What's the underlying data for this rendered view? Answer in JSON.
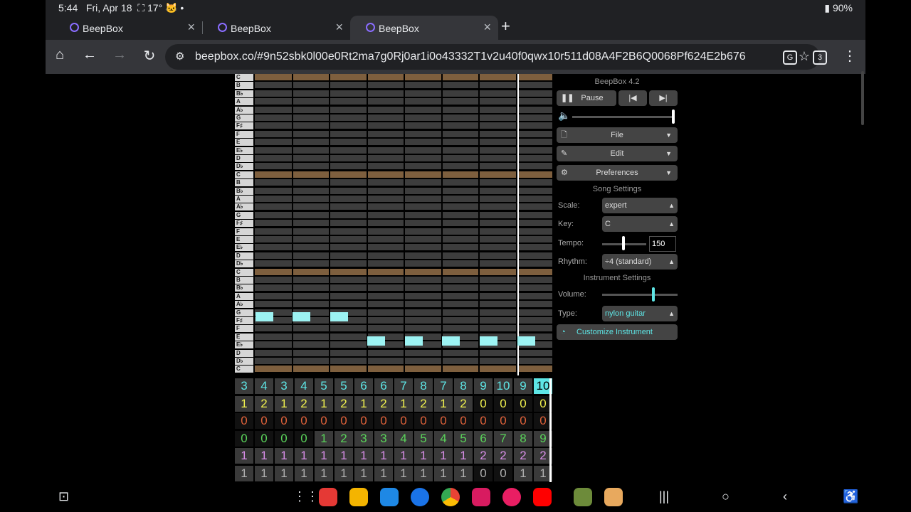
{
  "status_bar": {
    "time": "5:44",
    "date": "Fri, Apr 18",
    "temp": "17°",
    "battery": "90%"
  },
  "tabs": [
    {
      "title": "BeepBox",
      "active": false
    },
    {
      "title": "BeepBox",
      "active": false
    },
    {
      "title": "BeepBox",
      "active": true
    }
  ],
  "toolbar": {
    "url": "beepbox.co/#9n52sbk0l00e0Rt2ma7g0Rj0ar1i0o43332T1v2u40f0qwx10r511d08A4F2B6Q0068Pf624E2b676",
    "tab_count": "3"
  },
  "piano_keys": [
    "C",
    "B",
    "B♭",
    "A",
    "A♭",
    "G",
    "F♯",
    "F",
    "E",
    "E♭",
    "D",
    "D♭",
    "C",
    "B",
    "B♭",
    "A",
    "A♭",
    "G",
    "F♯",
    "F",
    "E",
    "E♭",
    "D",
    "D♭",
    "C",
    "B",
    "B♭",
    "A",
    "A♭",
    "G",
    "F♯",
    "F",
    "E",
    "E♭",
    "D",
    "D♭",
    "C"
  ],
  "track_rows": [
    {
      "color": "#5ee6e6",
      "values": [
        "3",
        "4",
        "3",
        "4",
        "5",
        "5",
        "6",
        "6",
        "7",
        "8",
        "7",
        "8",
        "9",
        "10",
        "9",
        "10"
      ]
    },
    {
      "color": "#f2f24f",
      "values": [
        "1",
        "2",
        "1",
        "2",
        "1",
        "2",
        "1",
        "2",
        "1",
        "2",
        "1",
        "2",
        "0",
        "0",
        "0",
        "0"
      ]
    },
    {
      "color": "#e0623a",
      "values": [
        "0",
        "0",
        "0",
        "0",
        "0",
        "0",
        "0",
        "0",
        "0",
        "0",
        "0",
        "0",
        "0",
        "0",
        "0",
        "0"
      ]
    },
    {
      "color": "#5ad35a",
      "values": [
        "0",
        "0",
        "0",
        "0",
        "1",
        "2",
        "3",
        "3",
        "4",
        "5",
        "4",
        "5",
        "6",
        "7",
        "8",
        "9"
      ]
    },
    {
      "color": "#d88ee8",
      "values": [
        "1",
        "1",
        "1",
        "1",
        "1",
        "1",
        "1",
        "1",
        "1",
        "1",
        "1",
        "1",
        "2",
        "2",
        "2",
        "2"
      ]
    },
    {
      "color": "#b0b0b0",
      "values": [
        "1",
        "1",
        "1",
        "1",
        "1",
        "1",
        "1",
        "1",
        "1",
        "1",
        "1",
        "1",
        "0",
        "0",
        "1",
        "1"
      ]
    }
  ],
  "panel": {
    "version": "BeepBox 4.2",
    "pause_label": "Pause",
    "file_label": "File",
    "edit_label": "Edit",
    "prefs_label": "Preferences",
    "song_settings": "Song Settings",
    "scale_label": "Scale:",
    "scale_value": "expert",
    "key_label": "Key:",
    "key_value": "C",
    "tempo_label": "Tempo:",
    "tempo_value": "150",
    "rhythm_label": "Rhythm:",
    "rhythm_value": "÷4 (standard)",
    "instrument_settings": "Instrument Settings",
    "volume_label": "Volume:",
    "type_label": "Type:",
    "type_value": "nylon guitar",
    "customize_label": "Customize Instrument",
    "accent": "#5ee6e6"
  }
}
